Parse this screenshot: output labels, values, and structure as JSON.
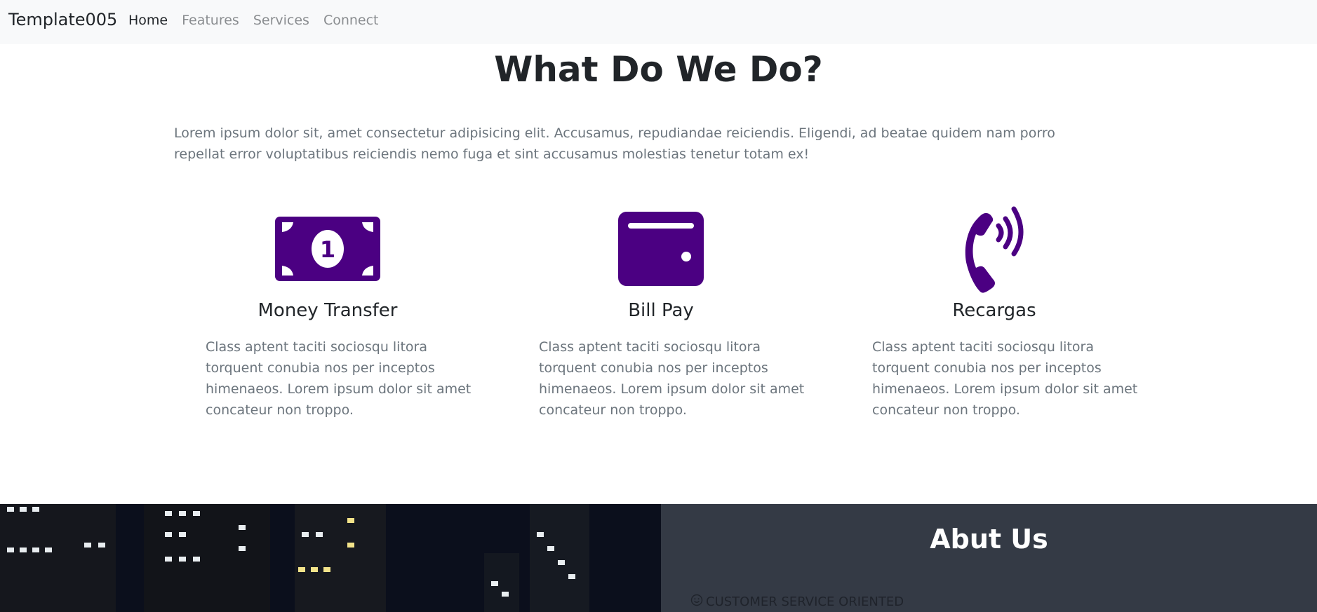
{
  "navbar": {
    "brand": "Template005",
    "links": [
      {
        "label": "Home",
        "active": true
      },
      {
        "label": "Features",
        "active": false
      },
      {
        "label": "Services",
        "active": false
      },
      {
        "label": "Connect",
        "active": false
      }
    ]
  },
  "services": {
    "title": "What Do We Do?",
    "intro": "Lorem ipsum dolor sit, amet consectetur adipisicing elit. Accusamus, repudiandae reiciendis. Eligendi, ad beatae quidem nam porro repellat error voluptatibus reiciendis nemo fuga et sint accusamus molestias tenetur totam ex!",
    "accent_color": "#4b0082",
    "items": [
      {
        "icon": "money-bill-icon",
        "title": "Money Transfer",
        "text": "Class aptent taciti sociosqu litora torquent conubia nos per inceptos himenaeos. Lorem ipsum dolor sit amet concateur non troppo."
      },
      {
        "icon": "wallet-icon",
        "title": "Bill Pay",
        "text": "Class aptent taciti sociosqu litora torquent conubia nos per inceptos himenaeos. Lorem ipsum dolor sit amet concateur non troppo."
      },
      {
        "icon": "phone-volume-icon",
        "title": "Recargas",
        "text": "Class aptent taciti sociosqu litora torquent conubia nos per inceptos himenaeos. Lorem ipsum dolor sit amet concateur non troppo."
      }
    ]
  },
  "about": {
    "title": "Abut Us",
    "first_point": "CUSTOMER SERVICE ORIENTED",
    "first_point_icon": "smile-icon"
  }
}
